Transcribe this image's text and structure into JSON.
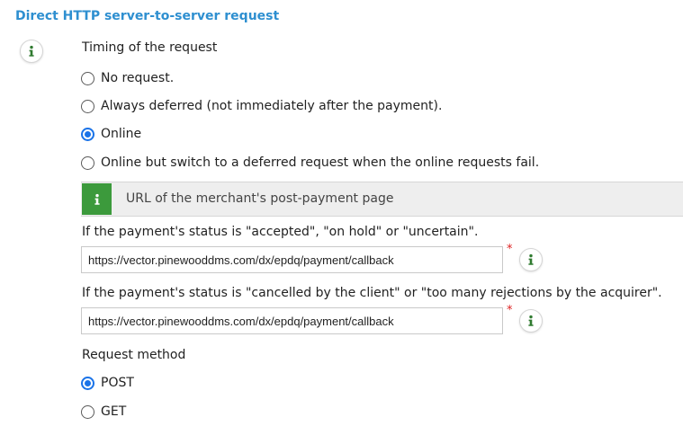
{
  "section": {
    "title": "Direct HTTP server-to-server request"
  },
  "timing": {
    "label": "Timing of the request",
    "options": [
      {
        "label": "No request.",
        "checked": false
      },
      {
        "label": "Always deferred (not immediately after the payment).",
        "checked": false
      },
      {
        "label": "Online",
        "checked": true
      },
      {
        "label": "Online but switch to a deferred request when the online requests fail.",
        "checked": false
      }
    ]
  },
  "banner": {
    "title": "URL of the merchant's post-payment page",
    "icon": "info-icon",
    "color": "#3c9a3c"
  },
  "accepted": {
    "label": "If the payment's status is \"accepted\", \"on hold\" or \"uncertain\".",
    "value": "https://vector.pinewooddms.com/dx/epdq/payment/callback",
    "required_mark": "*"
  },
  "cancelled": {
    "label": "If the payment's status is \"cancelled by the client\" or \"too many rejections by the acquirer\".",
    "value": "https://vector.pinewooddms.com/dx/epdq/payment/callback",
    "required_mark": "*"
  },
  "method": {
    "label": "Request method",
    "options": [
      {
        "label": "POST",
        "checked": true
      },
      {
        "label": "GET",
        "checked": false
      }
    ]
  },
  "colors": {
    "title": "#2e8fd0",
    "radio_accent": "#1a73e8",
    "required": "#dd2222"
  }
}
